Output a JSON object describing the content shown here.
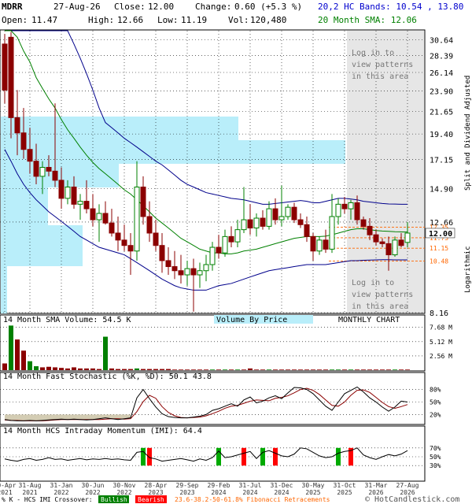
{
  "header": {
    "ticker": "MDRR",
    "date": "27-Aug-26",
    "close_label": "Close:",
    "close": "12.00",
    "change_label": "Change:",
    "change": "0.60 (+5.3 %)",
    "open_label": "Open:",
    "open": "11.47",
    "high_label": "High:",
    "high": "12.66",
    "low_label": "Low:",
    "low": "11.19",
    "vol_label": "Vol:",
    "vol": "120,480",
    "bands_label": "20,2 HC Bands: 10.54 , 13.80",
    "sma_label": "20 Month SMA: 12.06"
  },
  "side_labels": {
    "adjusted": "Split and Dividend Adjusted",
    "scale": "Logarithmic"
  },
  "overlay_text": {
    "login_top": [
      "Log in to",
      "view patterns",
      "in this area"
    ],
    "login_bottom": [
      "Log in to",
      "view patterns",
      "in this area"
    ]
  },
  "panel_labels": {
    "volume": "14 Month SMA Volume: 54.5 K",
    "vbp": "Volume By Price",
    "period": "MONTHLY CHART",
    "stoch": "14 Month Fast Stochastic (%K, %D): 50.1  43.8",
    "stoch_k": "%K",
    "stoch_d": "%D",
    "imi": "14 Month HCS Intraday Momentum (IMI): 64.4"
  },
  "footer": {
    "legend_prefix": "% K - HCS IMI Crossover:",
    "bullish": "Bullish",
    "bearish": "Bearish",
    "fib": "23.6-38.2-50-61.8% Fibonacci Retracements",
    "copyright": "© HotCandlestick.com"
  },
  "colors": {
    "up": "#008000",
    "down": "#8b0000",
    "sma": "#008000",
    "bands": "#00008b",
    "vbp": "#b9eefa",
    "overlay": "#e6e6e6",
    "fib": "#ff6600",
    "stoch_k": "#000000",
    "stoch_d": "#8b0000",
    "stoch_fill": "#c8bfa0"
  },
  "chart_data": {
    "type": "candlestick",
    "title": "MDRR",
    "scale": "log",
    "price_ticks": [
      30.64,
      28.39,
      26.14,
      23.9,
      21.65,
      19.4,
      17.15,
      14.9,
      12.66,
      8.16
    ],
    "price_range": [
      8.16,
      32.0
    ],
    "current_close": 12.0,
    "fib_levels": [
      12.35,
      11.73,
      11.15,
      10.48
    ],
    "x_tick_labels": [
      "30-Apr 2021",
      "31-Aug 2021",
      "31-Jan 2022",
      "30-Jun 2022",
      "30-Nov 2022",
      "28-Apr 2023",
      "29-Sep 2023",
      "29-Feb 2024",
      "31-Jul 2024",
      "31-Dec 2024",
      "30-May 2025",
      "31-Oct 2025",
      "31-Mar 2026",
      "27-Aug 2026"
    ],
    "x_tick_months": [
      0,
      4,
      9,
      14,
      19,
      24,
      29,
      34,
      39,
      44,
      49,
      54,
      59,
      64
    ],
    "candles": [
      {
        "o": 30.0,
        "h": 31.5,
        "l": 22.5,
        "c": 24.0
      },
      {
        "o": 31.0,
        "h": 31.8,
        "l": 19.0,
        "c": 21.0
      },
      {
        "o": 21.0,
        "h": 24.0,
        "l": 17.5,
        "c": 19.5
      },
      {
        "o": 19.5,
        "h": 22.0,
        "l": 17.2,
        "c": 18.0
      },
      {
        "o": 18.0,
        "h": 20.0,
        "l": 16.0,
        "c": 17.0
      },
      {
        "o": 17.0,
        "h": 18.5,
        "l": 15.2,
        "c": 15.8
      },
      {
        "o": 15.8,
        "h": 17.0,
        "l": 14.5,
        "c": 16.5
      },
      {
        "o": 16.5,
        "h": 17.5,
        "l": 15.8,
        "c": 16.2
      },
      {
        "o": 16.2,
        "h": 22.5,
        "l": 15.0,
        "c": 15.5
      },
      {
        "o": 15.5,
        "h": 16.5,
        "l": 13.5,
        "c": 14.2
      },
      {
        "o": 14.2,
        "h": 15.5,
        "l": 13.8,
        "c": 15.0
      },
      {
        "o": 15.0,
        "h": 15.8,
        "l": 13.5,
        "c": 13.8
      },
      {
        "o": 13.8,
        "h": 14.5,
        "l": 12.8,
        "c": 14.0
      },
      {
        "o": 14.0,
        "h": 15.5,
        "l": 13.2,
        "c": 13.5
      },
      {
        "o": 13.5,
        "h": 14.5,
        "l": 12.4,
        "c": 12.8
      },
      {
        "o": 12.8,
        "h": 13.8,
        "l": 11.5,
        "c": 13.2
      },
      {
        "o": 13.2,
        "h": 14.0,
        "l": 12.5,
        "c": 12.6
      },
      {
        "o": 12.6,
        "h": 13.5,
        "l": 11.8,
        "c": 12.0
      },
      {
        "o": 12.0,
        "h": 13.0,
        "l": 11.0,
        "c": 11.6
      },
      {
        "o": 11.6,
        "h": 12.5,
        "l": 11.0,
        "c": 11.3
      },
      {
        "o": 11.3,
        "h": 12.0,
        "l": 9.8,
        "c": 11.0
      },
      {
        "o": 11.0,
        "h": 17.0,
        "l": 10.5,
        "c": 15.0
      },
      {
        "o": 15.0,
        "h": 15.8,
        "l": 12.5,
        "c": 13.0
      },
      {
        "o": 13.0,
        "h": 14.0,
        "l": 11.5,
        "c": 12.0
      },
      {
        "o": 12.0,
        "h": 12.8,
        "l": 11.0,
        "c": 11.3
      },
      {
        "o": 11.3,
        "h": 12.0,
        "l": 9.9,
        "c": 10.5
      },
      {
        "o": 10.5,
        "h": 11.2,
        "l": 9.8,
        "c": 10.2
      },
      {
        "o": 10.2,
        "h": 11.0,
        "l": 9.6,
        "c": 10.0
      },
      {
        "o": 10.0,
        "h": 10.8,
        "l": 9.4,
        "c": 9.8
      },
      {
        "o": 9.8,
        "h": 10.5,
        "l": 9.3,
        "c": 10.1
      },
      {
        "o": 10.1,
        "h": 10.6,
        "l": 8.2,
        "c": 9.8
      },
      {
        "o": 9.8,
        "h": 10.4,
        "l": 9.2,
        "c": 10.0
      },
      {
        "o": 10.0,
        "h": 10.8,
        "l": 9.5,
        "c": 10.3
      },
      {
        "o": 10.3,
        "h": 11.5,
        "l": 10.0,
        "c": 11.2
      },
      {
        "o": 11.2,
        "h": 11.9,
        "l": 10.6,
        "c": 10.9
      },
      {
        "o": 10.9,
        "h": 12.2,
        "l": 10.7,
        "c": 11.8
      },
      {
        "o": 11.8,
        "h": 12.4,
        "l": 11.2,
        "c": 11.5
      },
      {
        "o": 11.5,
        "h": 12.8,
        "l": 11.2,
        "c": 12.2
      },
      {
        "o": 12.2,
        "h": 15.0,
        "l": 12.0,
        "c": 12.8
      },
      {
        "o": 12.8,
        "h": 13.8,
        "l": 11.9,
        "c": 12.3
      },
      {
        "o": 12.3,
        "h": 13.2,
        "l": 11.8,
        "c": 12.9
      },
      {
        "o": 12.9,
        "h": 13.4,
        "l": 12.2,
        "c": 12.4
      },
      {
        "o": 12.4,
        "h": 14.0,
        "l": 12.2,
        "c": 13.5
      },
      {
        "o": 13.5,
        "h": 14.2,
        "l": 12.5,
        "c": 12.8
      },
      {
        "o": 12.8,
        "h": 15.1,
        "l": 12.4,
        "c": 13.0
      },
      {
        "o": 13.0,
        "h": 13.8,
        "l": 12.8,
        "c": 13.6
      },
      {
        "o": 13.6,
        "h": 13.9,
        "l": 12.6,
        "c": 12.8
      },
      {
        "o": 12.8,
        "h": 13.2,
        "l": 12.3,
        "c": 12.5
      },
      {
        "o": 12.5,
        "h": 13.0,
        "l": 11.5,
        "c": 11.8
      },
      {
        "o": 11.8,
        "h": 12.0,
        "l": 10.5,
        "c": 11.0
      },
      {
        "o": 11.0,
        "h": 11.8,
        "l": 10.8,
        "c": 11.6
      },
      {
        "o": 11.6,
        "h": 12.2,
        "l": 10.9,
        "c": 11.1
      },
      {
        "o": 11.1,
        "h": 14.5,
        "l": 10.9,
        "c": 13.0
      },
      {
        "o": 13.0,
        "h": 14.2,
        "l": 12.5,
        "c": 13.8
      },
      {
        "o": 13.8,
        "h": 14.3,
        "l": 13.2,
        "c": 13.5
      },
      {
        "o": 13.5,
        "h": 14.1,
        "l": 12.8,
        "c": 13.9
      },
      {
        "o": 13.9,
        "h": 14.4,
        "l": 12.5,
        "c": 12.8
      },
      {
        "o": 12.8,
        "h": 13.0,
        "l": 12.2,
        "c": 12.4
      },
      {
        "o": 12.4,
        "h": 12.9,
        "l": 11.6,
        "c": 11.9
      },
      {
        "o": 11.9,
        "h": 12.2,
        "l": 11.3,
        "c": 11.5
      },
      {
        "o": 11.5,
        "h": 11.7,
        "l": 11.2,
        "c": 11.4
      },
      {
        "o": 11.4,
        "h": 11.8,
        "l": 10.0,
        "c": 10.8
      },
      {
        "o": 10.8,
        "h": 11.8,
        "l": 10.7,
        "c": 11.6
      },
      {
        "o": 11.6,
        "h": 12.0,
        "l": 11.2,
        "c": 11.3
      },
      {
        "o": 11.47,
        "h": 12.66,
        "l": 11.19,
        "c": 12.0
      }
    ],
    "sma20": [
      33.5,
      33.0,
      31.0,
      29.0,
      27.5,
      25.5,
      24.2,
      23.0,
      22.0,
      20.8,
      19.8,
      19.0,
      18.2,
      17.5,
      16.9,
      16.4,
      16.0,
      15.6,
      15.2,
      14.8,
      14.5,
      14.1,
      13.7,
      13.3,
      12.9,
      12.6,
      12.3,
      12.0,
      11.7,
      11.5,
      11.3,
      11.1,
      11.0,
      10.9,
      10.9,
      10.85,
      10.85,
      10.9,
      11.0,
      11.05,
      11.1,
      11.2,
      11.3,
      11.4,
      11.5,
      11.6,
      11.7,
      11.75,
      11.8,
      11.8,
      11.8,
      11.82,
      11.9,
      12.0,
      12.1,
      12.2,
      12.25,
      12.25,
      12.2,
      12.15,
      12.12,
      12.1,
      12.08,
      12.07,
      12.06
    ],
    "band_upper": [
      33.5,
      33.5,
      33.5,
      33.5,
      33.5,
      33.5,
      33.5,
      33.5,
      33.5,
      33.5,
      32.0,
      30.0,
      28.0,
      26.0,
      24.0,
      22.0,
      20.5,
      20.0,
      19.5,
      19.0,
      18.6,
      18.2,
      17.8,
      17.4,
      17.0,
      16.7,
      16.3,
      15.9,
      15.5,
      15.2,
      15.0,
      14.8,
      14.6,
      14.5,
      14.4,
      14.3,
      14.2,
      14.15,
      14.1,
      14.0,
      13.9,
      13.8,
      13.8,
      13.85,
      13.9,
      13.95,
      14.0,
      14.05,
      14.0,
      13.9,
      13.9,
      14.0,
      14.1,
      14.2,
      14.2,
      14.15,
      14.1,
      14.0,
      13.95,
      13.9,
      13.85,
      13.82,
      13.81,
      13.8,
      13.8
    ],
    "band_lower": [
      18.0,
      17.0,
      16.0,
      15.2,
      14.6,
      14.1,
      13.7,
      13.3,
      13.0,
      12.7,
      12.4,
      12.1,
      11.8,
      11.6,
      11.4,
      11.2,
      11.1,
      11.0,
      10.9,
      10.8,
      10.6,
      10.4,
      10.2,
      10.0,
      9.8,
      9.6,
      9.45,
      9.3,
      9.2,
      9.15,
      9.1,
      9.1,
      9.1,
      9.2,
      9.3,
      9.35,
      9.4,
      9.5,
      9.6,
      9.7,
      9.8,
      9.9,
      10.0,
      10.05,
      10.1,
      10.15,
      10.2,
      10.25,
      10.3,
      10.3,
      10.3,
      10.3,
      10.35,
      10.4,
      10.45,
      10.5,
      10.5,
      10.52,
      10.53,
      10.54,
      10.55,
      10.55,
      10.54,
      10.54,
      10.54
    ],
    "volume": {
      "ticks": [
        "7.68 M",
        "5.12 M",
        "2.56 M"
      ],
      "tick_values": [
        7.68,
        5.12,
        2.56
      ],
      "max": 8.2,
      "values": [
        1.2,
        8.0,
        5.5,
        3.5,
        1.6,
        0.7,
        0.5,
        0.6,
        0.5,
        0.4,
        0.3,
        0.5,
        0.3,
        0.3,
        0.3,
        0.2,
        6.0,
        0.3,
        0.2,
        0.2,
        0.2,
        0.3,
        0.2,
        0.2,
        0.2,
        0.2,
        0.2,
        0.1,
        0.1,
        0.1,
        0.1,
        0.1,
        0.1,
        0.1,
        0.1,
        0.1,
        0.1,
        0.1,
        0.1,
        0.3,
        0.1,
        0.1,
        0.1,
        0.1,
        0.1,
        0.1,
        0.1,
        0.1,
        0.1,
        0.1,
        0.1,
        0.1,
        0.1,
        0.1,
        0.1,
        0.1,
        0.1,
        0.1,
        0.1,
        0.1,
        0.1,
        0.1,
        0.1,
        0.1,
        0.1
      ],
      "up_months": [
        1,
        4,
        5,
        16,
        21,
        33,
        35,
        37,
        42,
        52,
        53,
        55,
        62
      ]
    },
    "stochastic": {
      "levels": [
        "80%",
        "50%",
        "20%"
      ],
      "k": [
        8,
        6,
        5,
        5,
        6,
        5,
        6,
        7,
        8,
        9,
        8,
        9,
        8,
        7,
        8,
        10,
        12,
        10,
        8,
        10,
        12,
        60,
        80,
        58,
        38,
        22,
        15,
        13,
        12,
        12,
        14,
        16,
        20,
        30,
        34,
        40,
        46,
        40,
        55,
        62,
        48,
        52,
        60,
        65,
        58,
        72,
        85,
        84,
        80,
        70,
        55,
        40,
        30,
        50,
        70,
        78,
        86,
        74,
        60,
        50,
        38,
        28,
        38,
        52,
        50
      ],
      "d": [
        7,
        6,
        6,
        5,
        5,
        5,
        5,
        6,
        7,
        8,
        8,
        8,
        8,
        8,
        8,
        8,
        9,
        10,
        10,
        9,
        10,
        27,
        51,
        66,
        59,
        39,
        25,
        17,
        13,
        12,
        13,
        14,
        17,
        22,
        28,
        35,
        40,
        42,
        47,
        52,
        55,
        54,
        53,
        59,
        61,
        65,
        72,
        80,
        83,
        78,
        68,
        55,
        42,
        40,
        50,
        66,
        78,
        79,
        73,
        61,
        49,
        39,
        35,
        39,
        44
      ]
    },
    "imi": {
      "levels": [
        "70%",
        "50%",
        "30%"
      ],
      "values": [
        45,
        42,
        40,
        44,
        46,
        42,
        44,
        48,
        44,
        45,
        42,
        44,
        46,
        43,
        45,
        44,
        46,
        44,
        45,
        43,
        42,
        60,
        62,
        48,
        45,
        40,
        42,
        44,
        46,
        43,
        40,
        45,
        42,
        48,
        63,
        48,
        50,
        54,
        58,
        62,
        46,
        60,
        64,
        58,
        52,
        50,
        56,
        70,
        68,
        60,
        52,
        48,
        50,
        58,
        62,
        64,
        70,
        54,
        48,
        44,
        50,
        55,
        52,
        56,
        64
      ],
      "bullish_months": [
        22,
        34,
        41,
        53
      ],
      "bearish_months": [
        23,
        38,
        43,
        55
      ]
    }
  }
}
